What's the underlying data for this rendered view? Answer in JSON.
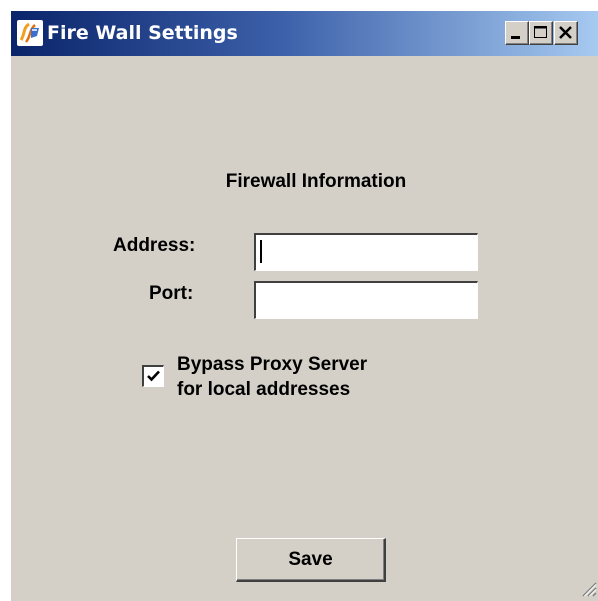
{
  "window": {
    "title": "Fire Wall Settings",
    "icon": "java-app-icon",
    "controls": [
      "minimize-icon",
      "maximize-icon",
      "close-icon"
    ]
  },
  "form": {
    "heading": "Firewall Information",
    "address_label": "Address:",
    "address_value": "",
    "port_label": "Port:",
    "port_value": "",
    "bypass_checked": true,
    "bypass_label_line1": "Bypass Proxy Server",
    "bypass_label_line2": "for local addresses",
    "save_label": "Save"
  },
  "colors": {
    "window_bg": "#d4d0c8",
    "titlebar_start": "#0a246a",
    "titlebar_end": "#a6caf0",
    "title_text": "#ffffff"
  }
}
